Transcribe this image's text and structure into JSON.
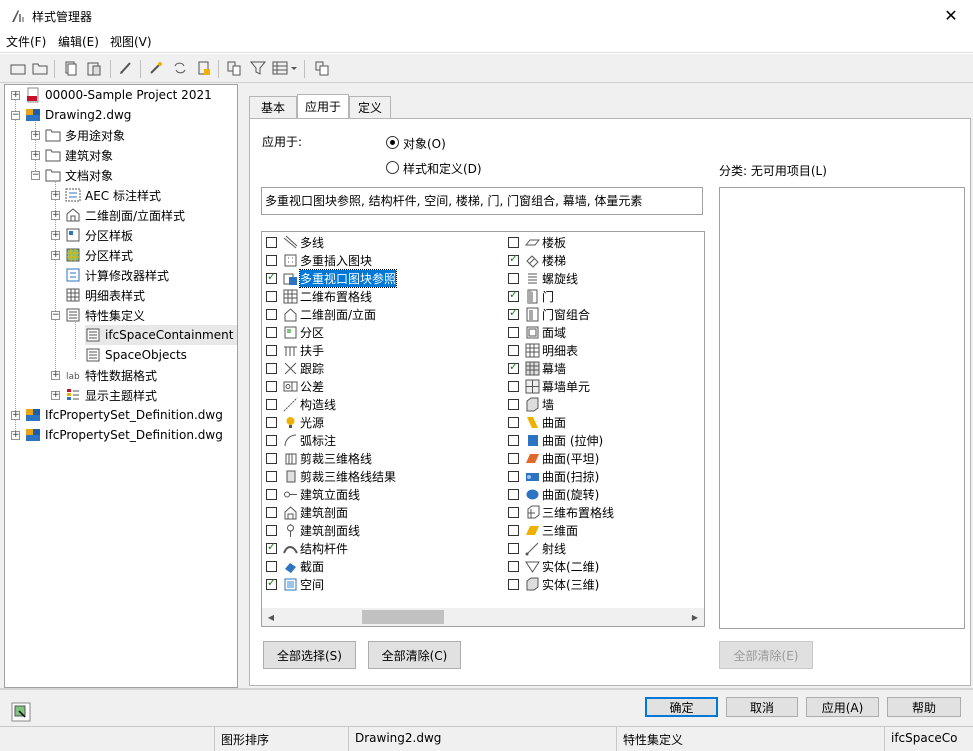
{
  "window": {
    "title": "样式管理器",
    "close": "✕"
  },
  "menu": [
    "文件(F)",
    "编辑(E)",
    "视图(V)"
  ],
  "tree": [
    {
      "label": "00000-Sample Project 2021",
      "icon": "project-icon"
    },
    {
      "label": "Drawing2.dwg",
      "icon": "drawing-icon"
    },
    {
      "label": "多用途对象",
      "icon": "folder-icon"
    },
    {
      "label": "建筑对象",
      "icon": "folder-icon"
    },
    {
      "label": "文档对象",
      "icon": "folder-icon"
    },
    {
      "label": "AEC 标注样式",
      "icon": "dimension-style-icon"
    },
    {
      "label": "二维剖面/立面样式",
      "icon": "section-elevation-icon"
    },
    {
      "label": "分区样板",
      "icon": "zone-template-icon"
    },
    {
      "label": "分区样式",
      "icon": "zone-style-icon"
    },
    {
      "label": "计算修改器样式",
      "icon": "calculation-modifier-icon"
    },
    {
      "label": "明细表样式",
      "icon": "schedule-table-icon"
    },
    {
      "label": "特性集定义",
      "icon": "property-set-icon"
    },
    {
      "label": "ifcSpaceContainment",
      "icon": "property-set-item-icon"
    },
    {
      "label": "SpaceObjects",
      "icon": "property-set-item-icon"
    },
    {
      "label": "特性数据格式",
      "icon": "data-format-icon"
    },
    {
      "label": "显示主题样式",
      "icon": "display-theme-icon"
    },
    {
      "label": "IfcPropertySet_Definition.dwg",
      "icon": "drawing-icon"
    },
    {
      "label": "IfcPropertySet_Definition.dwg",
      "icon": "drawing-icon"
    }
  ],
  "tabs": [
    "基本",
    "应用于",
    "定义"
  ],
  "applies": {
    "label": "应用于:",
    "radio_objects": "对象(O)",
    "radio_styles": "样式和定义(D)",
    "summary": "多重视口图块参照, 结构杆件, 空间, 楼梯, 门, 门窗组合, 幕墙, 体量元素",
    "category_label": "分类: 无可用项目(L)"
  },
  "left_items": [
    {
      "label": "多线",
      "checked": false
    },
    {
      "label": "多重插入图块",
      "checked": false
    },
    {
      "label": "多重视口图块参照",
      "checked": true,
      "selected": true
    },
    {
      "label": "二维布置格线",
      "checked": false
    },
    {
      "label": "二维剖面/立面",
      "checked": false
    },
    {
      "label": "分区",
      "checked": false
    },
    {
      "label": "扶手",
      "checked": false
    },
    {
      "label": "跟踪",
      "checked": false
    },
    {
      "label": "公差",
      "checked": false
    },
    {
      "label": "构造线",
      "checked": false
    },
    {
      "label": "光源",
      "checked": false
    },
    {
      "label": "弧标注",
      "checked": false
    },
    {
      "label": "剪裁三维格线",
      "checked": false
    },
    {
      "label": "剪裁三维格线结果",
      "checked": false
    },
    {
      "label": "建筑立面线",
      "checked": false
    },
    {
      "label": "建筑剖面",
      "checked": false
    },
    {
      "label": "建筑剖面线",
      "checked": false
    },
    {
      "label": "结构杆件",
      "checked": true
    },
    {
      "label": "截面",
      "checked": false
    },
    {
      "label": "空间",
      "checked": true
    }
  ],
  "right_items": [
    {
      "label": "楼板",
      "checked": false
    },
    {
      "label": "楼梯",
      "checked": true
    },
    {
      "label": "螺旋线",
      "checked": false
    },
    {
      "label": "门",
      "checked": true
    },
    {
      "label": "门窗组合",
      "checked": true
    },
    {
      "label": "面域",
      "checked": false
    },
    {
      "label": "明细表",
      "checked": false
    },
    {
      "label": "幕墙",
      "checked": true
    },
    {
      "label": "幕墙单元",
      "checked": false
    },
    {
      "label": "墙",
      "checked": false
    },
    {
      "label": "曲面",
      "checked": false
    },
    {
      "label": "曲面 (拉伸)",
      "checked": false
    },
    {
      "label": "曲面(平坦)",
      "checked": false
    },
    {
      "label": "曲面(扫掠)",
      "checked": false
    },
    {
      "label": "曲面(旋转)",
      "checked": false
    },
    {
      "label": "三维布置格线",
      "checked": false
    },
    {
      "label": "三维面",
      "checked": false
    },
    {
      "label": "射线",
      "checked": false
    },
    {
      "label": "实体(二维)",
      "checked": false
    },
    {
      "label": "实体(三维)",
      "checked": false
    }
  ],
  "buttons": {
    "select_all": "全部选择(S)",
    "clear_all": "全部清除(C)",
    "clear_all_cat": "全部清除(E)",
    "ok": "确定",
    "cancel": "取消",
    "apply": "应用(A)",
    "help": "帮助"
  },
  "status": [
    "图形排序",
    "Drawing2.dwg",
    "特性集定义",
    "ifcSpaceCo"
  ],
  "colors": {
    "accent": "#0078d7",
    "check": "#1a7f1a"
  }
}
